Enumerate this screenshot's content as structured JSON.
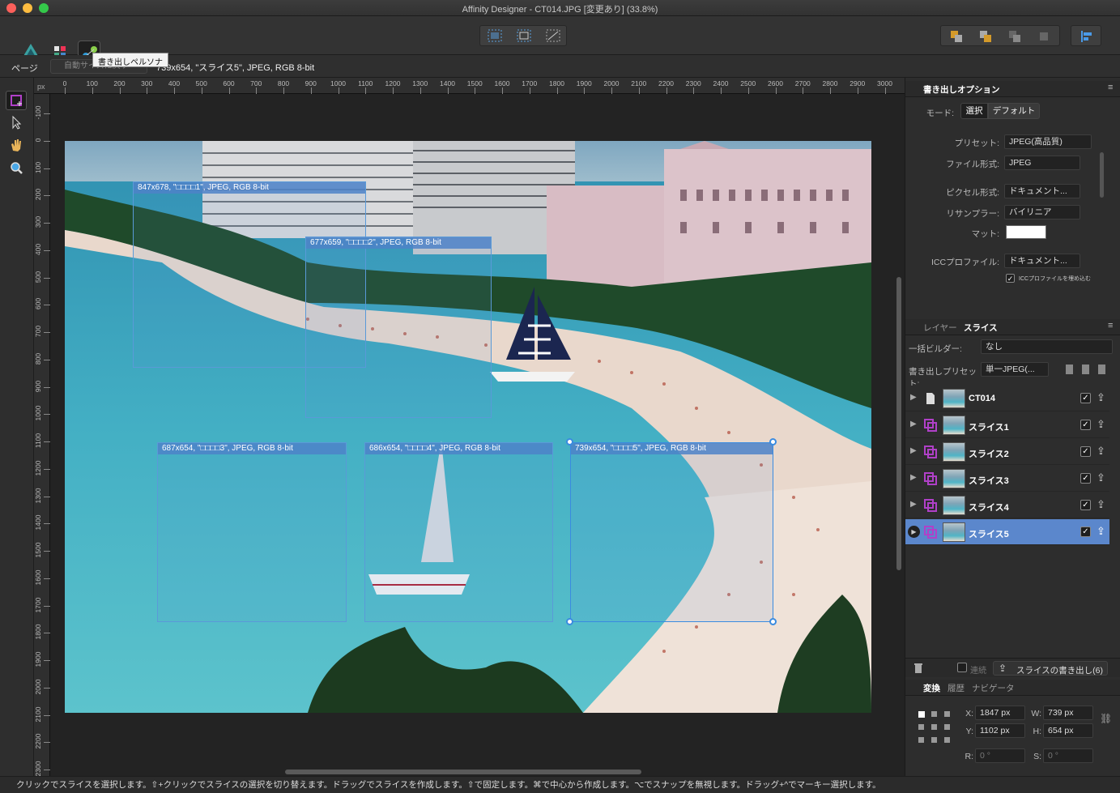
{
  "window": {
    "title": "Affinity Designer - CT014.JPG [変更あり] (33.8%)"
  },
  "toolbar": {
    "tooltip": "書き出しペルソナ"
  },
  "context": {
    "page_label": "ページ",
    "autofit_label": "自動サイズに戻す",
    "selection_info": "739x654, \"スライス5\", JPEG, RGB 8-bit"
  },
  "ruler": {
    "unit": "px",
    "h_ticks": [
      "0",
      "100",
      "200",
      "300",
      "400",
      "500",
      "600",
      "700",
      "800",
      "900",
      "1000",
      "1100",
      "1200",
      "1300",
      "1400",
      "1500",
      "1600",
      "1700",
      "1800",
      "1900",
      "2000",
      "2100",
      "2200",
      "2300",
      "2400",
      "2500",
      "2600",
      "2700",
      "2800",
      "2900",
      "3000"
    ],
    "v_ticks": [
      "-100",
      "0",
      "100",
      "200",
      "300",
      "400",
      "500",
      "600",
      "700",
      "800",
      "900",
      "1000",
      "1100",
      "1200",
      "1300",
      "1400",
      "1500",
      "1600",
      "1700",
      "1800",
      "1900",
      "2000",
      "2100",
      "2200",
      "2300"
    ]
  },
  "slices": [
    {
      "label": "847x678, \"□□□□1\", JPEG, RGB 8-bit"
    },
    {
      "label": "677x659, \"□□□□2\", JPEG, RGB 8-bit"
    },
    {
      "label": "687x654, \"□□□□3\", JPEG, RGB 8-bit"
    },
    {
      "label": "686x654, \"□□□□4\", JPEG, RGB 8-bit"
    },
    {
      "label": "739x654, \"□□□□5\", JPEG, RGB 8-bit"
    }
  ],
  "export_options": {
    "tab": "書き出しオプション",
    "mode_label": "モード:",
    "mode_select": "選択",
    "mode_default": "デフォルト",
    "preset_label": "プリセット:",
    "preset": "JPEG(高品質)",
    "format_label": "ファイル形式:",
    "format": "JPEG",
    "pixel_label": "ピクセル形式:",
    "pixel": "ドキュメント...",
    "resample_label": "リサンプラー:",
    "resample": "バイリニア",
    "matte_label": "マット:",
    "icc_label": "ICCプロファイル:",
    "icc": "ドキュメント...",
    "embed_icc": "ICCプロファイルを埋め込む"
  },
  "slices_panel": {
    "tab_layers": "レイヤー",
    "tab_slices": "スライス",
    "builder_label": "一括ビルダー:",
    "builder": "なし",
    "export_preset_label": "書き出しプリセット:",
    "export_preset": "単一JPEG(...",
    "rows": [
      {
        "name": "CT014"
      },
      {
        "name": "スライス1"
      },
      {
        "name": "スライス2"
      },
      {
        "name": "スライス3"
      },
      {
        "name": "スライス4"
      },
      {
        "name": "スライス5"
      }
    ],
    "continuous_label": "連続",
    "export_button": "スライスの書き出し(6)"
  },
  "transform": {
    "tab_transform": "変換",
    "tab_history": "履歴",
    "tab_navigator": "ナビゲータ",
    "x_label": "X:",
    "x": "1847 px",
    "y_label": "Y:",
    "y": "1102 px",
    "w_label": "W:",
    "w": "739 px",
    "h_label": "H:",
    "h": "654 px",
    "r_label": "R:",
    "r": "0 °",
    "s_label": "S:",
    "s": "0 °"
  },
  "status": {
    "text": "クリックでスライスを選択します。⇧+クリックでスライスの選択を切り替えます。ドラッグでスライスを作成します。⇧で固定します。⌘で中心から作成します。⌥でスナップを無視します。ドラッグ+^でマーキー選択します。"
  }
}
